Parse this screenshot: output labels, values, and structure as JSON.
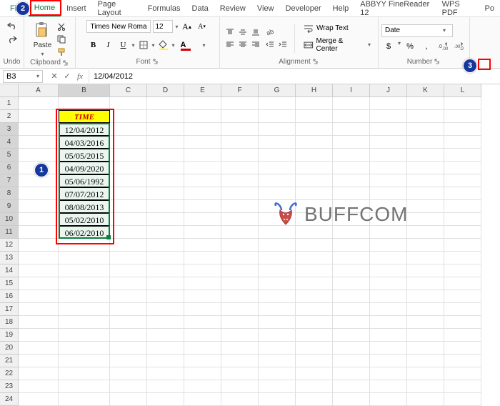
{
  "tabs": {
    "file": "File",
    "home": "Home",
    "insert": "Insert",
    "page_layout": "Page Layout",
    "formulas": "Formulas",
    "data": "Data",
    "review": "Review",
    "view": "View",
    "developer": "Developer",
    "help": "Help",
    "abbyy": "ABBYY FineReader 12",
    "wps": "WPS PDF",
    "po": "Po"
  },
  "ribbon": {
    "undo_label": "Undo",
    "clipboard_label": "Clipboard",
    "paste_label": "Paste",
    "font_label": "Font",
    "font_name": "Times New Roman",
    "font_size": "12",
    "bold": "B",
    "italic": "I",
    "underline": "U",
    "alignment_label": "Alignment",
    "wrap_text": "Wrap Text",
    "merge_center": "Merge & Center",
    "number_label": "Number",
    "number_format": "Date",
    "currency": "$",
    "percent": "%",
    "comma": ","
  },
  "formula_bar": {
    "name_box": "B3",
    "formula": "12/04/2012"
  },
  "columns": [
    "A",
    "B",
    "C",
    "D",
    "E",
    "F",
    "G",
    "H",
    "I",
    "J",
    "K",
    "L"
  ],
  "rows_count": 24,
  "sheet": {
    "header_label": "TIME",
    "dates": [
      "12/04/2012",
      "04/03/2016",
      "05/05/2015",
      "04/09/2020",
      "05/06/1992",
      "07/07/2012",
      "08/08/2013",
      "05/02/2010",
      "06/02/2010"
    ]
  },
  "watermark": "BUFFCOM",
  "steps": {
    "s1": "1",
    "s2": "2",
    "s3": "3"
  },
  "colors": {
    "accent": "#0f7b3e",
    "badge": "#16379b",
    "highlight": "#ffff00",
    "header_text": "#d00000"
  }
}
